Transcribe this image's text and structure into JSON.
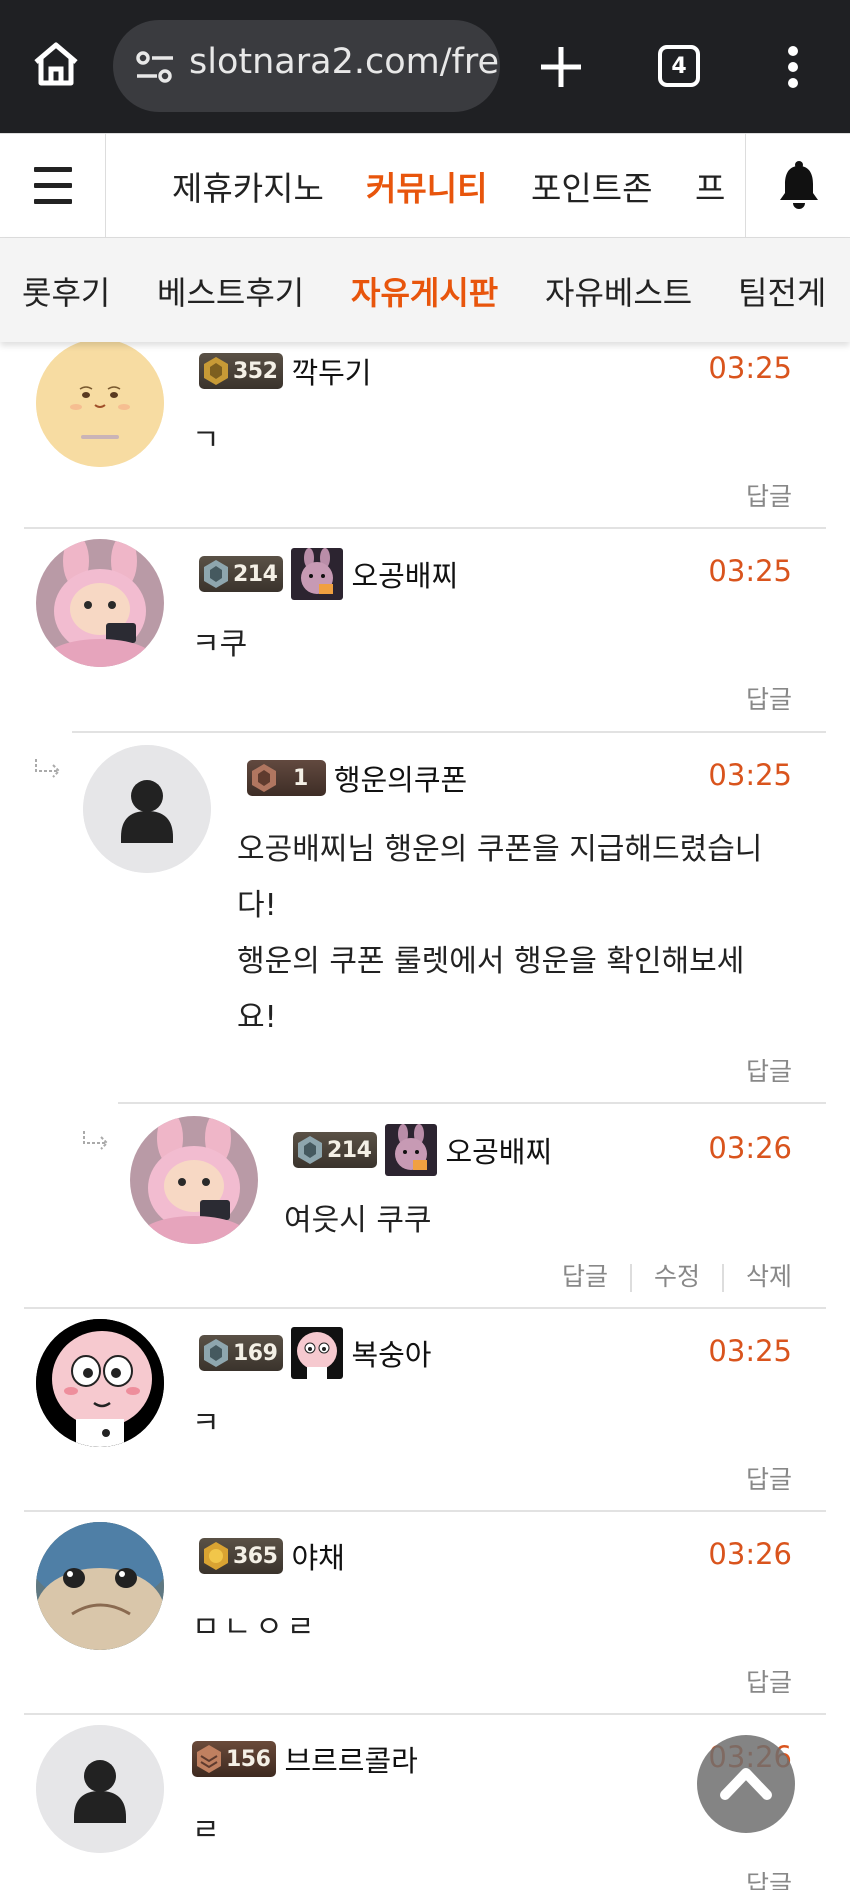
{
  "browser": {
    "url": "slotnara2.com/fre",
    "tab_count": "4"
  },
  "site_nav": {
    "items": [
      {
        "label": "제휴카지노",
        "active": false
      },
      {
        "label": "커뮤니티",
        "active": true
      },
      {
        "label": "포인트존",
        "active": false
      },
      {
        "label": "프",
        "active": false
      }
    ]
  },
  "sub_nav": {
    "items": [
      {
        "label": "롯후기",
        "active": false
      },
      {
        "label": "베스트후기",
        "active": false
      },
      {
        "label": "자유게시판",
        "active": true
      },
      {
        "label": "자유베스트",
        "active": false
      },
      {
        "label": "팀전게",
        "active": false
      }
    ]
  },
  "comments": [
    {
      "level": "352",
      "nickname": "깍두기",
      "time": "03:25",
      "content": "ㄱ",
      "actions": [
        "답글"
      ],
      "avatar": "pudding-face"
    },
    {
      "level": "214",
      "nickname": "오공배찌",
      "time": "03:25",
      "content": "ㅋ쿠",
      "actions": [
        "답글"
      ],
      "avatar": "pink-bunny"
    },
    {
      "level": "1",
      "nickname": "행운의쿠폰",
      "time": "03:25",
      "content_lines": [
        "오공배찌님 행운의 쿠폰을 지급해드렸습니",
        "다!",
        "행운의 쿠폰 룰렛에서 행운을 확인해보세",
        "요!"
      ],
      "actions": [
        "답글"
      ],
      "avatar": "default-user"
    },
    {
      "level": "214",
      "nickname": "오공배찌",
      "time": "03:26",
      "content": "여읏시 쿠쿠",
      "actions": [
        "답글",
        "수정",
        "삭제"
      ],
      "avatar": "pink-bunny"
    },
    {
      "level": "169",
      "nickname": "복숭아",
      "time": "03:25",
      "content": "ㅋ",
      "actions": [
        "답글"
      ],
      "avatar": "peach-character"
    },
    {
      "level": "365",
      "nickname": "야채",
      "time": "03:26",
      "content": "ㅁㄴㅇㄹ",
      "actions": [
        "답글"
      ],
      "avatar": "seal-closeup"
    },
    {
      "level": "156",
      "nickname": "브르르콜라",
      "time": "03:26",
      "content": "ㄹ",
      "actions": [
        "답글"
      ],
      "avatar": "default-user"
    }
  ],
  "colors": {
    "accent": "#e8550c",
    "time": "#d9541d",
    "browser_bar": "#1f2023"
  }
}
